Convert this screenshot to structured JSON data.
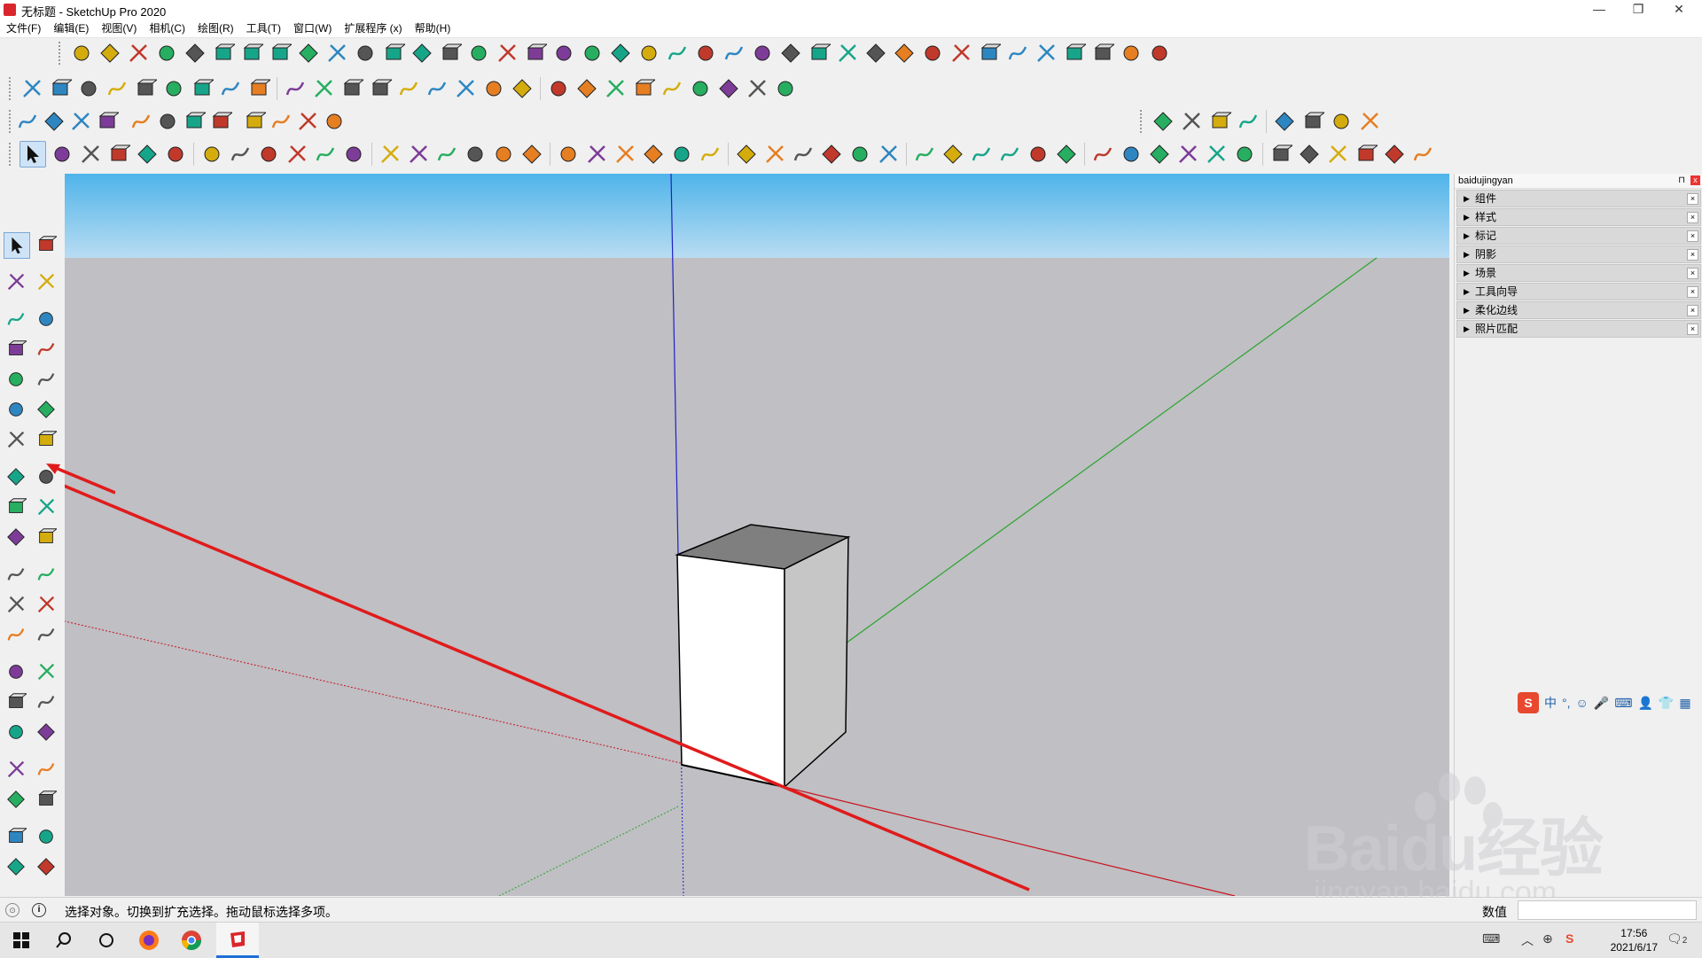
{
  "window": {
    "title": "无标题 - SketchUp Pro 2020",
    "minimize": "—",
    "maximize": "❐",
    "close": "✕"
  },
  "menu": [
    "文件(F)",
    "编辑(E)",
    "视图(V)",
    "相机(C)",
    "绘图(R)",
    "工具(T)",
    "窗口(W)",
    "扩展程序 (x)",
    "帮助(H)"
  ],
  "tray": {
    "title": "baidujingyan",
    "pin": "⊓",
    "close": "x",
    "panels": [
      "组件",
      "样式",
      "标记",
      "阴影",
      "场景",
      "工具向导",
      "柔化边线",
      "照片匹配"
    ]
  },
  "ime": {
    "logo": "S",
    "items": [
      "中",
      "°,",
      "☺",
      "🎤",
      "⌨",
      "👤",
      "👕",
      "▦"
    ]
  },
  "status": {
    "text": "选择对象。切换到扩充选择。拖动鼠标选择多项。",
    "info": "i",
    "geo": "⊙",
    "measurements_label": "数值",
    "measurements_value": ""
  },
  "taskbar": {
    "time": "17:56",
    "date": "2021/6/17",
    "notif": "2"
  },
  "watermark": {
    "text": "Baidu经验",
    "sub": "jingyan.baidu.com"
  },
  "colors": {
    "sky_top": "#4fb4ea",
    "ground": "#bfbfc4",
    "axis_red": "#c8141e",
    "axis_green": "#2aa52a",
    "axis_blue": "#2020c8",
    "arrow": "#e01b1b"
  },
  "icons": {
    "row1": [
      "push-pull-icon",
      "polyline-icon",
      "follow-me-icon",
      "cut-icon",
      "ruby-icon",
      "shape-icon",
      "rope-icon",
      "box-icon",
      "sphere-icon",
      "dome-icon",
      "fillet-icon",
      "chamfer-icon",
      "offset-icon",
      "arc-icon",
      "building-icon",
      "roof-icon",
      "columns-icon",
      "stairs-icon",
      "mesh-icon",
      "curtain-icon",
      "arrow-icon",
      "stack-icon",
      "slope-icon",
      "branch-icon",
      "branch2-icon",
      "branch3-icon",
      "cylinder-icon",
      "pattern-icon",
      "slab-icon",
      "railing-icon",
      "fence-icon",
      "grid-icon",
      "lines-icon",
      "bars-icon",
      "net-icon",
      "diamond-icon",
      "ramp-icon",
      "stripes-icon",
      "house-icon"
    ],
    "row2": [
      "curve-icon",
      "wave-icon",
      "spline-icon",
      "bezier-icon",
      "edge-icon",
      "arc-green-icon",
      "rect-icon",
      "circle-icon",
      "arc2-icon",
      "zigzag-icon",
      "hook-icon",
      "hook2-icon",
      "loop-icon",
      "line-icon",
      "polygon-icon",
      "wrench-icon",
      "oval-icon",
      "triangle-icon",
      "house-pin-icon",
      "house-red-icon",
      "house-blue-icon",
      "house-r-icon",
      "house-green-icon",
      "house-n-icon",
      "house-x-icon",
      "house-f-icon",
      "tree-icon"
    ],
    "row3a": [
      "orbit-icon",
      "zoom-icon",
      "zoom-window-icon",
      "zoom-extents-icon",
      "previous-icon",
      "pan-icon",
      "walk-icon",
      "look-icon",
      "footprint-icon",
      "pencil-tool-icon",
      "warehouse-icon",
      "extension-icon"
    ],
    "row3b": [
      "layers-icon",
      "layers2-icon",
      "layers3-icon",
      "layers4-icon",
      "crosshair-icon",
      "iso-icon",
      "top-icon",
      "front-icon"
    ],
    "row4": [
      "select-icon",
      "eraser-icon",
      "pencil-icon",
      "arc-tool-icon",
      "rectangle-tool-icon",
      "push-pull-tool-icon",
      "offset-tool-icon",
      "move-tool-icon",
      "rotate-tool-icon",
      "scale-tool-icon",
      "tape-icon",
      "text-icon",
      "paint-icon",
      "orbit-tool-icon",
      "pan-tool-icon",
      "zoom-tool-icon",
      "extents-tool-icon",
      "3dwarehouse-icon",
      "components-icon",
      "send-icon",
      "ruby-gem-icon",
      "account-icon",
      "xray-icon",
      "back-edges-icon",
      "wireframe-icon",
      "hidden-line-icon",
      "shaded-icon",
      "textured-icon",
      "monochrome-icon",
      "iso-view-icon",
      "top-view-icon",
      "front-view-icon",
      "right-view-icon",
      "back-view-icon",
      "left-view-icon",
      "bottom-view-icon",
      "section-icon",
      "section2-icon",
      "section3-icon",
      "section4-icon",
      "warehouse2-icon",
      "ext-warehouse-icon",
      "layout-icon",
      "style-builder-icon",
      "solid-icon",
      "shield-icon",
      "fruit-icon",
      "model-icon"
    ]
  }
}
